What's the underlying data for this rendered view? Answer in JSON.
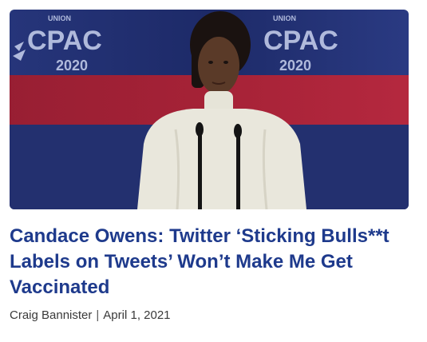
{
  "article": {
    "image": {
      "subject": "speaker-at-podium",
      "backdrop_logo_text": "CPAC",
      "backdrop_logo_year": "2020",
      "backdrop_logo_small": "UNION",
      "colors": {
        "backdrop": "#1f2c6e",
        "stripe": "#b81f2e",
        "sweater": "#e9e7dc",
        "skin": "#5a3a28"
      }
    },
    "headline": "Candace Owens: Twitter ‘Sticking Bulls**t Labels on Tweets’ Won’t Make Me Get Vaccinated",
    "author": "Craig Bannister",
    "separator": "|",
    "date": "April 1, 2021"
  }
}
